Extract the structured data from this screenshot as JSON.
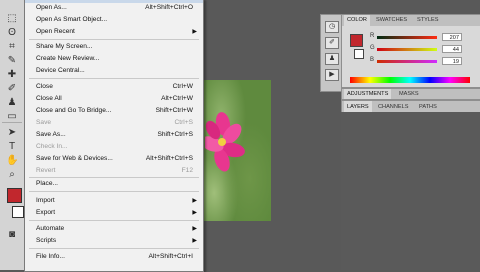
{
  "menu": {
    "items": [
      {
        "label": "Open As...",
        "shortcut": "Alt+Shift+Ctrl+O",
        "submenu": false,
        "disabled": false
      },
      {
        "label": "Open As Smart Object...",
        "shortcut": "",
        "submenu": false,
        "disabled": false
      },
      {
        "label": "Open Recent",
        "shortcut": "",
        "submenu": true,
        "disabled": false
      },
      {
        "label": "Share My Screen...",
        "shortcut": "",
        "submenu": false,
        "disabled": false
      },
      {
        "label": "Create New Review...",
        "shortcut": "",
        "submenu": false,
        "disabled": false
      },
      {
        "label": "Device Central...",
        "shortcut": "",
        "submenu": false,
        "disabled": false
      },
      {
        "label": "Close",
        "shortcut": "Ctrl+W",
        "submenu": false,
        "disabled": false
      },
      {
        "label": "Close All",
        "shortcut": "Alt+Ctrl+W",
        "submenu": false,
        "disabled": false
      },
      {
        "label": "Close and Go To Bridge...",
        "shortcut": "Shift+Ctrl+W",
        "submenu": false,
        "disabled": false
      },
      {
        "label": "Save",
        "shortcut": "Ctrl+S",
        "submenu": false,
        "disabled": true
      },
      {
        "label": "Save As...",
        "shortcut": "Shift+Ctrl+S",
        "submenu": false,
        "disabled": false
      },
      {
        "label": "Check In...",
        "shortcut": "",
        "submenu": false,
        "disabled": true
      },
      {
        "label": "Save for Web & Devices...",
        "shortcut": "Alt+Shift+Ctrl+S",
        "submenu": false,
        "disabled": false
      },
      {
        "label": "Revert",
        "shortcut": "F12",
        "submenu": false,
        "disabled": true
      },
      {
        "label": "Place...",
        "shortcut": "",
        "submenu": false,
        "disabled": false
      },
      {
        "label": "Import",
        "shortcut": "",
        "submenu": true,
        "disabled": false
      },
      {
        "label": "Export",
        "shortcut": "",
        "submenu": true,
        "disabled": false
      },
      {
        "label": "Automate",
        "shortcut": "",
        "submenu": true,
        "disabled": false
      },
      {
        "label": "Scripts",
        "shortcut": "",
        "submenu": true,
        "disabled": false
      },
      {
        "label": "File Info...",
        "shortcut": "Alt+Shift+Ctrl+I",
        "submenu": false,
        "disabled": false
      }
    ]
  },
  "color_panel": {
    "tabs": [
      "COLOR",
      "SWATCHES",
      "STYLES"
    ],
    "r_label": "R",
    "g_label": "G",
    "b_label": "B",
    "r_value": "207",
    "g_value": "44",
    "b_value": "19",
    "foreground_color": "#c1272d",
    "background_color": "#ffffff"
  },
  "adjustments_panel": {
    "tabs": [
      "ADJUSTMENTS",
      "MASKS"
    ]
  },
  "layers_panel": {
    "tabs": [
      "LAYERS",
      "CHANNELS",
      "PATHS"
    ]
  },
  "colors": {
    "menu_bg": "#f1f1f1",
    "workspace": "#595959",
    "panel": "#d9d9d9"
  }
}
